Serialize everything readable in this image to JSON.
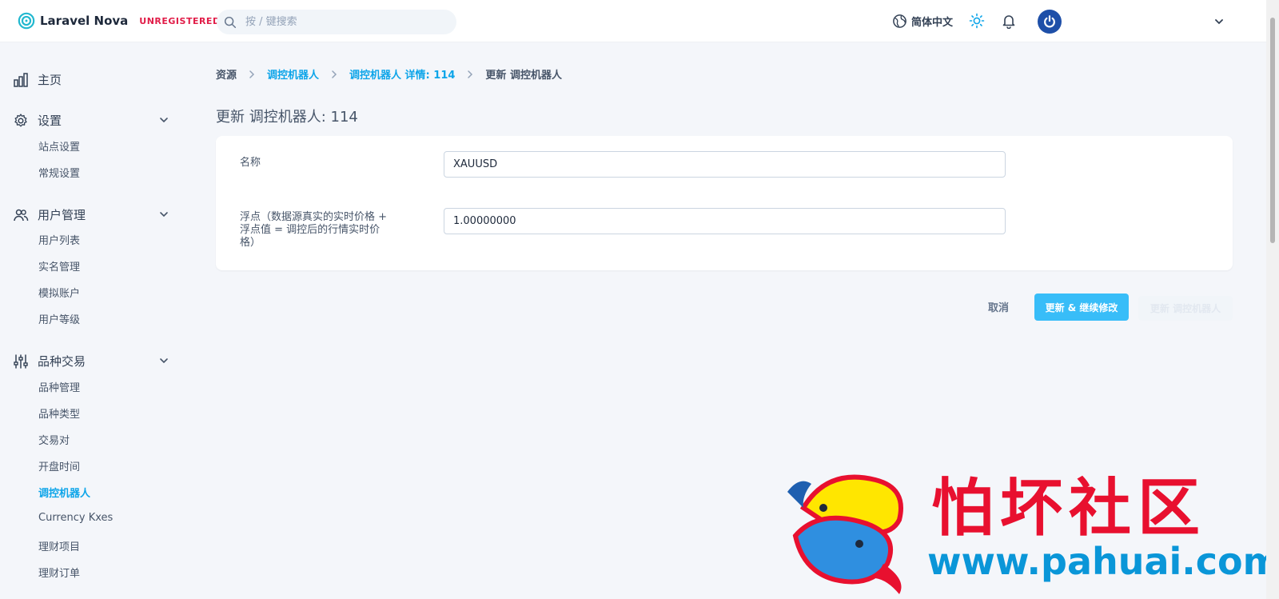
{
  "header": {
    "app_name": "Laravel Nova",
    "badge": "UNREGISTERED",
    "search_placeholder": "按 / 键搜索",
    "language": "简体中文"
  },
  "sidebar": {
    "sections": [
      {
        "label": "主页",
        "icon": "bar-chart-icon",
        "items": []
      },
      {
        "label": "设置",
        "icon": "gear-icon",
        "items": [
          "站点设置",
          "常规设置"
        ]
      },
      {
        "label": "用户管理",
        "icon": "users-icon",
        "items": [
          "用户列表",
          "实名管理",
          "模拟账户",
          "用户等级"
        ]
      },
      {
        "label": "品种交易",
        "icon": "sliders-icon",
        "items": [
          "品种管理",
          "品种类型",
          "交易对",
          "开盘时间",
          "调控机器人",
          "Currency Kxes",
          "理财项目",
          "理财订单"
        ]
      }
    ],
    "active_item": "调控机器人"
  },
  "breadcrumb": {
    "items": [
      "资源",
      "调控机器人",
      "调控机器人 详情: 114",
      "更新 调控机器人"
    ]
  },
  "page": {
    "title": "更新 调控机器人: 114"
  },
  "form": {
    "fields": [
      {
        "label": "名称",
        "value": "XAUUSD"
      },
      {
        "label_lines": [
          "浮点（数据源真实的实时价格 +",
          "浮点值 = 调控后的行情实时价",
          "格）"
        ],
        "value": "1.00000000"
      }
    ],
    "cancel_label": "取消",
    "update_continue_label": "更新 & 继续修改",
    "update_label": "更新 调控机器人"
  },
  "watermark": {
    "title": "怕坏社区",
    "url": "www.pahuai.com"
  },
  "colors": {
    "accent": "#0ea5e9",
    "primary_button": "#38bdf8",
    "badge": "#e11d48"
  }
}
